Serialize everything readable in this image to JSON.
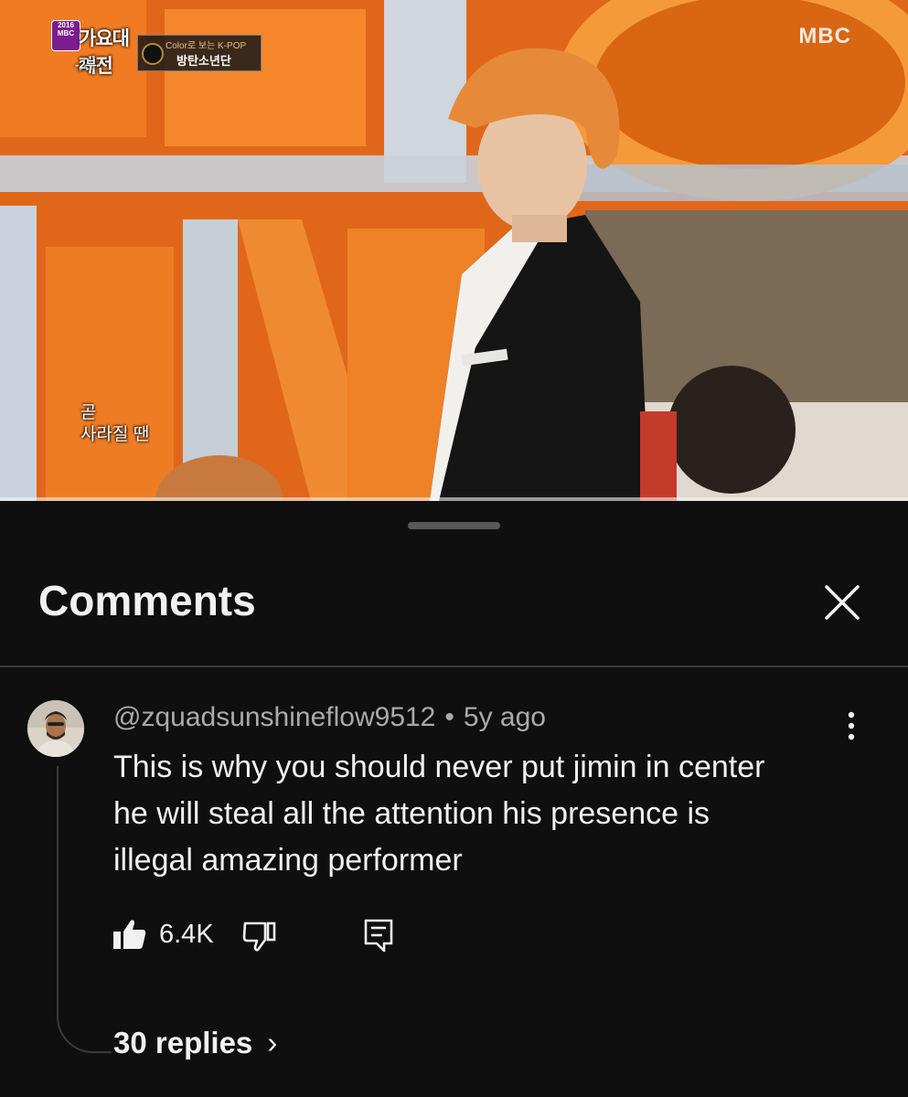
{
  "video": {
    "osd_logo_year": "2016 MBC",
    "osd_logo_title": "가요대제전",
    "osd_logo_part": "-2부-",
    "osd_tag_line1": "Color로 보는 K-POP",
    "osd_tag_line2": "방탄소년단",
    "channel_logo": "MBC",
    "lyric_line1": "곧",
    "lyric_line2": "사라질 땐"
  },
  "sheet": {
    "title": "Comments",
    "close_icon": "close-icon"
  },
  "comment": {
    "author": "@zquadsunshineflow9512",
    "separator": "•",
    "age": "5y ago",
    "text_line1": "This is why you should never put jimin in center",
    "text_line2": "he will steal all the attention his presence is",
    "text_line3": "illegal amazing performer",
    "likes": "6.4K",
    "icons": {
      "like": "thumbs-up-filled-icon",
      "dislike": "thumbs-down-outline-icon",
      "reply": "reply-comment-icon",
      "more": "more-vertical-icon"
    },
    "replies_label": "30 replies",
    "replies_chevron": "›"
  },
  "colors": {
    "background": "#0f0f0f",
    "secondary_text": "#aaaaaa",
    "primary_text": "#f1f1f1",
    "stage_orange": "#e86a14"
  }
}
